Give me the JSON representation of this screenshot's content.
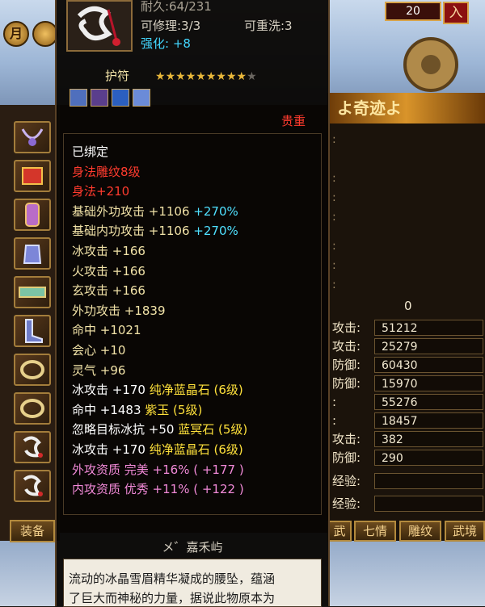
{
  "hud": {
    "level": "20",
    "enter_label": "入",
    "moon_label": "月"
  },
  "tooltip": {
    "durability": "耐久:64/231",
    "repairable": "可修理:3/3",
    "rewashable": "可重洗:3",
    "enhance": "强化: +8",
    "category": "护符",
    "star_rating": {
      "filled": 9,
      "total": 10
    },
    "gem_slots": [
      "ice-gem-icon",
      "purple-gem-icon",
      "blue-gem-icon",
      "ice-gem-icon"
    ],
    "rarity": "贵重",
    "properties": [
      {
        "text": "已绑定",
        "color": "#ffffff"
      },
      {
        "text": "身法雕纹8级",
        "color": "#ff3b2e"
      },
      {
        "text": "身法+210",
        "color": "#ff3b2e"
      },
      {
        "text": "基础外功攻击  +1106",
        "extra": "+270%",
        "color": "#f2e3a8",
        "extra_color": "#4fe0ff"
      },
      {
        "text": "基础内功攻击  +1106",
        "extra": "+270%",
        "color": "#f2e3a8",
        "extra_color": "#4fe0ff"
      },
      {
        "text": "冰攻击  +166",
        "color": "#f2e3a8"
      },
      {
        "text": "火攻击  +166",
        "color": "#f2e3a8"
      },
      {
        "text": "玄攻击  +166",
        "color": "#f2e3a8"
      },
      {
        "text": "外功攻击  +1839",
        "color": "#f2e3a8"
      },
      {
        "text": "命中  +1021",
        "color": "#f2e3a8"
      },
      {
        "text": "会心  +10",
        "color": "#f2e3a8"
      },
      {
        "text": "灵气  +96",
        "color": "#f2e3a8"
      },
      {
        "text": "冰攻击  +170",
        "extra": "纯净蓝晶石 (6级)",
        "color": "#ffffff",
        "extra_color": "#ffe13b"
      },
      {
        "text": "命中  +1483",
        "extra": "紫玉 (5级)",
        "color": "#ffffff",
        "extra_color": "#ffe13b"
      },
      {
        "text": "忽略目标冰抗  +50",
        "extra": "蓝冥石 (5级)",
        "color": "#ffffff",
        "extra_color": "#ffe13b"
      },
      {
        "text": "冰攻击  +170",
        "extra": "纯净蓝晶石 (6级)",
        "color": "#ffffff",
        "extra_color": "#ffe13b"
      },
      {
        "text": "外攻资质    完美",
        "extra": "+16% ( +177 )",
        "color": "#f28ad8",
        "extra_color": "#f28ad8"
      },
      {
        "text": "内攻资质    优秀",
        "extra": "+11% ( +122 )",
        "color": "#f28ad8",
        "extra_color": "#f28ad8"
      }
    ],
    "maker": "メ゛嘉禾屿",
    "description_line1": "流动的冰晶雪眉精华凝成的腰坠，蕴涵",
    "description_line2": "了巨大而神秘的力量，据说此物原本为"
  },
  "left_panel": {
    "equip_tab": "装备",
    "slots": [
      "necklace-icon",
      "bracer-icon",
      "cuff-icon",
      "gauntlet-icon",
      "belt-icon",
      "boots-icon",
      "ring-icon",
      "ring-icon",
      "amulet-icon",
      "amulet-icon"
    ]
  },
  "right_panel": {
    "banner": "よ奇迹よ",
    "zero_value": "0",
    "stats": [
      {
        "label": "攻击:",
        "value": "51212"
      },
      {
        "label": "攻击:",
        "value": "25279"
      },
      {
        "label": "防御:",
        "value": "60430"
      },
      {
        "label": "防御:",
        "value": "15970"
      },
      {
        "label": ":",
        "value": "55276"
      },
      {
        "label": ":",
        "value": "18457"
      },
      {
        "label": "攻击:",
        "value": "382"
      },
      {
        "label": "防御:",
        "value": "290"
      }
    ],
    "exp_label_1": "经验:",
    "exp_label_2": "经验:",
    "tabs": [
      "武",
      "七情",
      "雕纹",
      "武境"
    ]
  }
}
